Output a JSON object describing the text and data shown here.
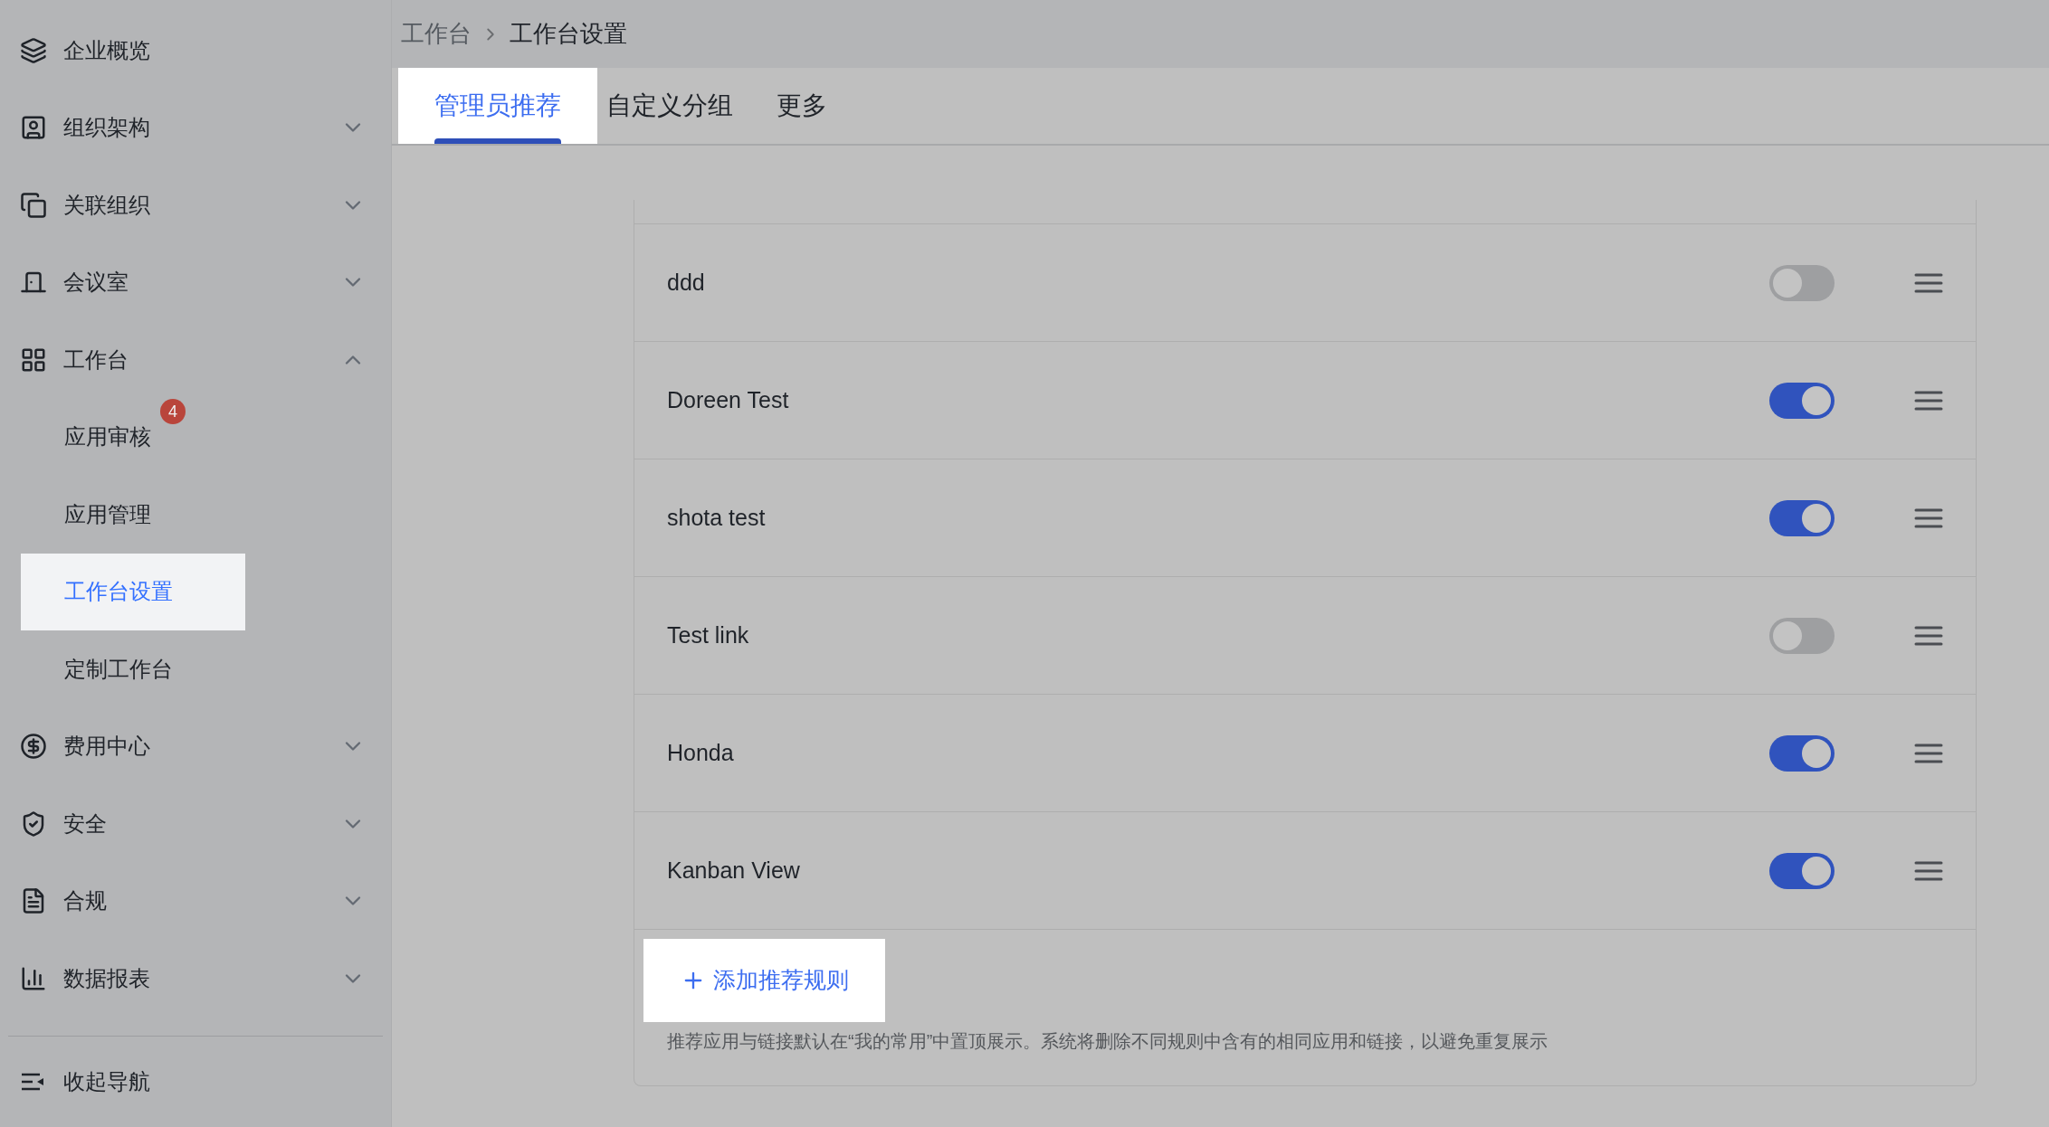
{
  "sidebar": {
    "items": [
      {
        "kind": "link",
        "label": "企业概览"
      },
      {
        "kind": "group",
        "label": "组织架构",
        "expanded": false
      },
      {
        "kind": "group",
        "label": "关联组织",
        "expanded": false
      },
      {
        "kind": "group",
        "label": "会议室",
        "expanded": false
      },
      {
        "kind": "group",
        "label": "工作台",
        "expanded": true,
        "children": [
          {
            "label": "应用审核",
            "badge": "4",
            "selected": false
          },
          {
            "label": "应用管理",
            "selected": false
          },
          {
            "label": "工作台设置",
            "selected": true
          },
          {
            "label": "定制工作台",
            "selected": false
          }
        ]
      },
      {
        "kind": "group",
        "label": "费用中心",
        "expanded": false
      },
      {
        "kind": "group",
        "label": "安全",
        "expanded": false
      },
      {
        "kind": "group",
        "label": "合规",
        "expanded": false
      },
      {
        "kind": "group",
        "label": "数据报表",
        "expanded": false
      }
    ],
    "collapse": "收起导航"
  },
  "breadcrumb": [
    "工作台",
    "工作台设置"
  ],
  "tabs": [
    {
      "label": "管理员推荐",
      "selected": true
    },
    {
      "label": "自定义分组",
      "selected": false
    },
    {
      "label": "更多",
      "selected": false
    }
  ],
  "rules": [
    {
      "name": "ddd",
      "on": false
    },
    {
      "name": "Doreen Test",
      "on": true
    },
    {
      "name": "shota test",
      "on": true
    },
    {
      "name": "Test link",
      "on": false
    },
    {
      "name": "Honda",
      "on": true
    },
    {
      "name": "Kanban View",
      "on": true
    }
  ],
  "add_button": "添加推荐规则",
  "hint": "推荐应用与链接默认在“我的常用”中置顶展示。系统将删除不同规则中含有的相同应用和链接，以避免重复展示"
}
